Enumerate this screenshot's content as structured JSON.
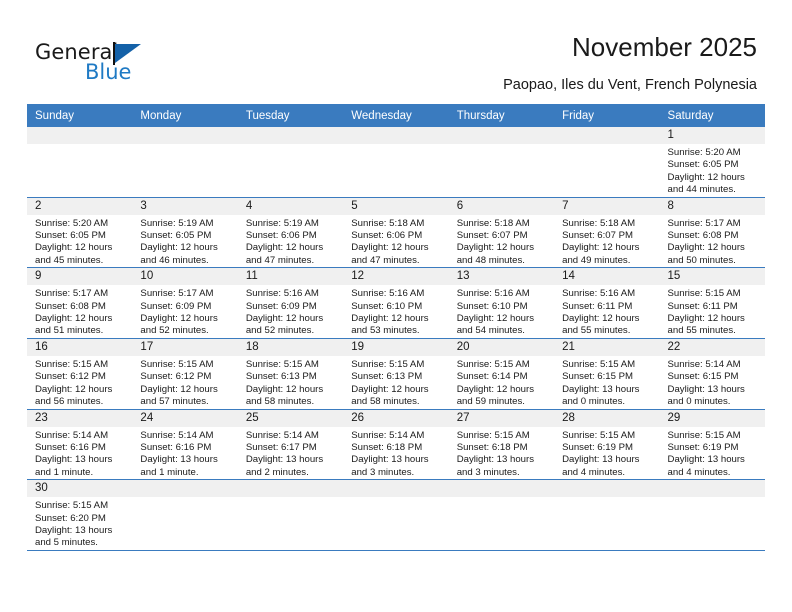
{
  "brand": {
    "name_top": "General",
    "name_bottom": "Blue",
    "accent_color": "#1f7ac4",
    "flag_color": "#1461a8"
  },
  "header": {
    "title": "November 2025",
    "subtitle": "Paopao, Iles du Vent, French Polynesia",
    "header_bg": "#3a7bbf",
    "daynum_bg": "#f0f0f0"
  },
  "weekdays": [
    "Sunday",
    "Monday",
    "Tuesday",
    "Wednesday",
    "Thursday",
    "Friday",
    "Saturday"
  ],
  "labels": {
    "sunrise": "Sunrise:",
    "sunset": "Sunset:",
    "daylight": "Daylight:"
  },
  "weeks": [
    [
      {
        "day": "",
        "empty": true
      },
      {
        "day": "",
        "empty": true
      },
      {
        "day": "",
        "empty": true
      },
      {
        "day": "",
        "empty": true
      },
      {
        "day": "",
        "empty": true
      },
      {
        "day": "",
        "empty": true
      },
      {
        "day": "1",
        "sunrise": "Sunrise: 5:20 AM",
        "sunset": "Sunset: 6:05 PM",
        "daylight_1": "Daylight: 12 hours",
        "daylight_2": "and 44 minutes."
      }
    ],
    [
      {
        "day": "2",
        "sunrise": "Sunrise: 5:20 AM",
        "sunset": "Sunset: 6:05 PM",
        "daylight_1": "Daylight: 12 hours",
        "daylight_2": "and 45 minutes."
      },
      {
        "day": "3",
        "sunrise": "Sunrise: 5:19 AM",
        "sunset": "Sunset: 6:05 PM",
        "daylight_1": "Daylight: 12 hours",
        "daylight_2": "and 46 minutes."
      },
      {
        "day": "4",
        "sunrise": "Sunrise: 5:19 AM",
        "sunset": "Sunset: 6:06 PM",
        "daylight_1": "Daylight: 12 hours",
        "daylight_2": "and 47 minutes."
      },
      {
        "day": "5",
        "sunrise": "Sunrise: 5:18 AM",
        "sunset": "Sunset: 6:06 PM",
        "daylight_1": "Daylight: 12 hours",
        "daylight_2": "and 47 minutes."
      },
      {
        "day": "6",
        "sunrise": "Sunrise: 5:18 AM",
        "sunset": "Sunset: 6:07 PM",
        "daylight_1": "Daylight: 12 hours",
        "daylight_2": "and 48 minutes."
      },
      {
        "day": "7",
        "sunrise": "Sunrise: 5:18 AM",
        "sunset": "Sunset: 6:07 PM",
        "daylight_1": "Daylight: 12 hours",
        "daylight_2": "and 49 minutes."
      },
      {
        "day": "8",
        "sunrise": "Sunrise: 5:17 AM",
        "sunset": "Sunset: 6:08 PM",
        "daylight_1": "Daylight: 12 hours",
        "daylight_2": "and 50 minutes."
      }
    ],
    [
      {
        "day": "9",
        "sunrise": "Sunrise: 5:17 AM",
        "sunset": "Sunset: 6:08 PM",
        "daylight_1": "Daylight: 12 hours",
        "daylight_2": "and 51 minutes."
      },
      {
        "day": "10",
        "sunrise": "Sunrise: 5:17 AM",
        "sunset": "Sunset: 6:09 PM",
        "daylight_1": "Daylight: 12 hours",
        "daylight_2": "and 52 minutes."
      },
      {
        "day": "11",
        "sunrise": "Sunrise: 5:16 AM",
        "sunset": "Sunset: 6:09 PM",
        "daylight_1": "Daylight: 12 hours",
        "daylight_2": "and 52 minutes."
      },
      {
        "day": "12",
        "sunrise": "Sunrise: 5:16 AM",
        "sunset": "Sunset: 6:10 PM",
        "daylight_1": "Daylight: 12 hours",
        "daylight_2": "and 53 minutes."
      },
      {
        "day": "13",
        "sunrise": "Sunrise: 5:16 AM",
        "sunset": "Sunset: 6:10 PM",
        "daylight_1": "Daylight: 12 hours",
        "daylight_2": "and 54 minutes."
      },
      {
        "day": "14",
        "sunrise": "Sunrise: 5:16 AM",
        "sunset": "Sunset: 6:11 PM",
        "daylight_1": "Daylight: 12 hours",
        "daylight_2": "and 55 minutes."
      },
      {
        "day": "15",
        "sunrise": "Sunrise: 5:15 AM",
        "sunset": "Sunset: 6:11 PM",
        "daylight_1": "Daylight: 12 hours",
        "daylight_2": "and 55 minutes."
      }
    ],
    [
      {
        "day": "16",
        "sunrise": "Sunrise: 5:15 AM",
        "sunset": "Sunset: 6:12 PM",
        "daylight_1": "Daylight: 12 hours",
        "daylight_2": "and 56 minutes."
      },
      {
        "day": "17",
        "sunrise": "Sunrise: 5:15 AM",
        "sunset": "Sunset: 6:12 PM",
        "daylight_1": "Daylight: 12 hours",
        "daylight_2": "and 57 minutes."
      },
      {
        "day": "18",
        "sunrise": "Sunrise: 5:15 AM",
        "sunset": "Sunset: 6:13 PM",
        "daylight_1": "Daylight: 12 hours",
        "daylight_2": "and 58 minutes."
      },
      {
        "day": "19",
        "sunrise": "Sunrise: 5:15 AM",
        "sunset": "Sunset: 6:13 PM",
        "daylight_1": "Daylight: 12 hours",
        "daylight_2": "and 58 minutes."
      },
      {
        "day": "20",
        "sunrise": "Sunrise: 5:15 AM",
        "sunset": "Sunset: 6:14 PM",
        "daylight_1": "Daylight: 12 hours",
        "daylight_2": "and 59 minutes."
      },
      {
        "day": "21",
        "sunrise": "Sunrise: 5:15 AM",
        "sunset": "Sunset: 6:15 PM",
        "daylight_1": "Daylight: 13 hours",
        "daylight_2": "and 0 minutes."
      },
      {
        "day": "22",
        "sunrise": "Sunrise: 5:14 AM",
        "sunset": "Sunset: 6:15 PM",
        "daylight_1": "Daylight: 13 hours",
        "daylight_2": "and 0 minutes."
      }
    ],
    [
      {
        "day": "23",
        "sunrise": "Sunrise: 5:14 AM",
        "sunset": "Sunset: 6:16 PM",
        "daylight_1": "Daylight: 13 hours",
        "daylight_2": "and 1 minute."
      },
      {
        "day": "24",
        "sunrise": "Sunrise: 5:14 AM",
        "sunset": "Sunset: 6:16 PM",
        "daylight_1": "Daylight: 13 hours",
        "daylight_2": "and 1 minute."
      },
      {
        "day": "25",
        "sunrise": "Sunrise: 5:14 AM",
        "sunset": "Sunset: 6:17 PM",
        "daylight_1": "Daylight: 13 hours",
        "daylight_2": "and 2 minutes."
      },
      {
        "day": "26",
        "sunrise": "Sunrise: 5:14 AM",
        "sunset": "Sunset: 6:18 PM",
        "daylight_1": "Daylight: 13 hours",
        "daylight_2": "and 3 minutes."
      },
      {
        "day": "27",
        "sunrise": "Sunrise: 5:15 AM",
        "sunset": "Sunset: 6:18 PM",
        "daylight_1": "Daylight: 13 hours",
        "daylight_2": "and 3 minutes."
      },
      {
        "day": "28",
        "sunrise": "Sunrise: 5:15 AM",
        "sunset": "Sunset: 6:19 PM",
        "daylight_1": "Daylight: 13 hours",
        "daylight_2": "and 4 minutes."
      },
      {
        "day": "29",
        "sunrise": "Sunrise: 5:15 AM",
        "sunset": "Sunset: 6:19 PM",
        "daylight_1": "Daylight: 13 hours",
        "daylight_2": "and 4 minutes."
      }
    ],
    [
      {
        "day": "30",
        "sunrise": "Sunrise: 5:15 AM",
        "sunset": "Sunset: 6:20 PM",
        "daylight_1": "Daylight: 13 hours",
        "daylight_2": "and 5 minutes."
      },
      {
        "day": "",
        "empty": true
      },
      {
        "day": "",
        "empty": true
      },
      {
        "day": "",
        "empty": true
      },
      {
        "day": "",
        "empty": true
      },
      {
        "day": "",
        "empty": true
      },
      {
        "day": "",
        "empty": true
      }
    ]
  ]
}
